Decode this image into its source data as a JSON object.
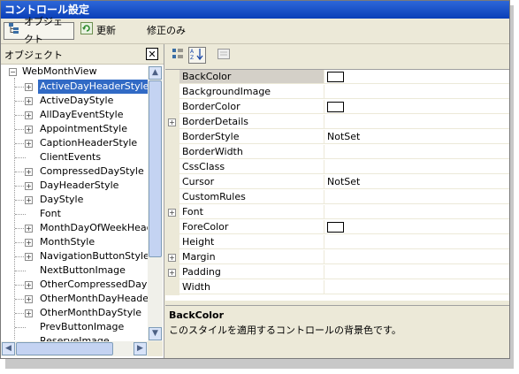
{
  "window": {
    "title": "コントロール設定"
  },
  "toolbar": {
    "object_label": "オブジェクト",
    "refresh_label": "更新",
    "modified_only_label": "修正のみ"
  },
  "left_panel": {
    "title": "オブジェクト",
    "close_glyph": "✕",
    "root": "WebMonthView",
    "items": [
      {
        "label": "ActiveDayHeaderStyle",
        "expandable": true,
        "selected": true
      },
      {
        "label": "ActiveDayStyle",
        "expandable": true
      },
      {
        "label": "AllDayEventStyle",
        "expandable": true
      },
      {
        "label": "AppointmentStyle",
        "expandable": true
      },
      {
        "label": "CaptionHeaderStyle",
        "expandable": true
      },
      {
        "label": "ClientEvents",
        "expandable": false
      },
      {
        "label": "CompressedDayStyle",
        "expandable": true
      },
      {
        "label": "DayHeaderStyle",
        "expandable": true
      },
      {
        "label": "DayStyle",
        "expandable": true
      },
      {
        "label": "Font",
        "expandable": false
      },
      {
        "label": "MonthDayOfWeekHeaderStyle",
        "expandable": true
      },
      {
        "label": "MonthStyle",
        "expandable": true
      },
      {
        "label": "NavigationButtonStyle",
        "expandable": true
      },
      {
        "label": "NextButtonImage",
        "expandable": false
      },
      {
        "label": "OtherCompressedDayStyle",
        "expandable": true
      },
      {
        "label": "OtherMonthDayHeaderStyle",
        "expandable": true
      },
      {
        "label": "OtherMonthDayStyle",
        "expandable": true
      },
      {
        "label": "PrevButtonImage",
        "expandable": false
      },
      {
        "label": "ReserveImage",
        "expandable": false
      }
    ]
  },
  "properties": [
    {
      "name": "BackColor",
      "value": "",
      "swatch": true,
      "expandable": false,
      "selected": true
    },
    {
      "name": "BackgroundImage",
      "value": "",
      "swatch": false,
      "expandable": false
    },
    {
      "name": "BorderColor",
      "value": "",
      "swatch": true,
      "expandable": false
    },
    {
      "name": "BorderDetails",
      "value": "",
      "swatch": false,
      "expandable": true
    },
    {
      "name": "BorderStyle",
      "value": "NotSet",
      "swatch": false,
      "expandable": false
    },
    {
      "name": "BorderWidth",
      "value": "",
      "swatch": false,
      "expandable": false
    },
    {
      "name": "CssClass",
      "value": "",
      "swatch": false,
      "expandable": false
    },
    {
      "name": "Cursor",
      "value": "NotSet",
      "swatch": false,
      "expandable": false
    },
    {
      "name": "CustomRules",
      "value": "",
      "swatch": false,
      "expandable": false
    },
    {
      "name": "Font",
      "value": "",
      "swatch": false,
      "expandable": true
    },
    {
      "name": "ForeColor",
      "value": "",
      "swatch": true,
      "expandable": false
    },
    {
      "name": "Height",
      "value": "",
      "swatch": false,
      "expandable": false
    },
    {
      "name": "Margin",
      "value": "",
      "swatch": false,
      "expandable": true
    },
    {
      "name": "Padding",
      "value": "",
      "swatch": false,
      "expandable": true
    },
    {
      "name": "Width",
      "value": "",
      "swatch": false,
      "expandable": false
    }
  ],
  "description": {
    "title": "BackColor",
    "text": "このスタイルを適用するコントロールの背景色です。"
  },
  "colors": {
    "title_bar": "#0a3fb8",
    "selection": "#316ac5",
    "panel": "#ece9d8"
  }
}
